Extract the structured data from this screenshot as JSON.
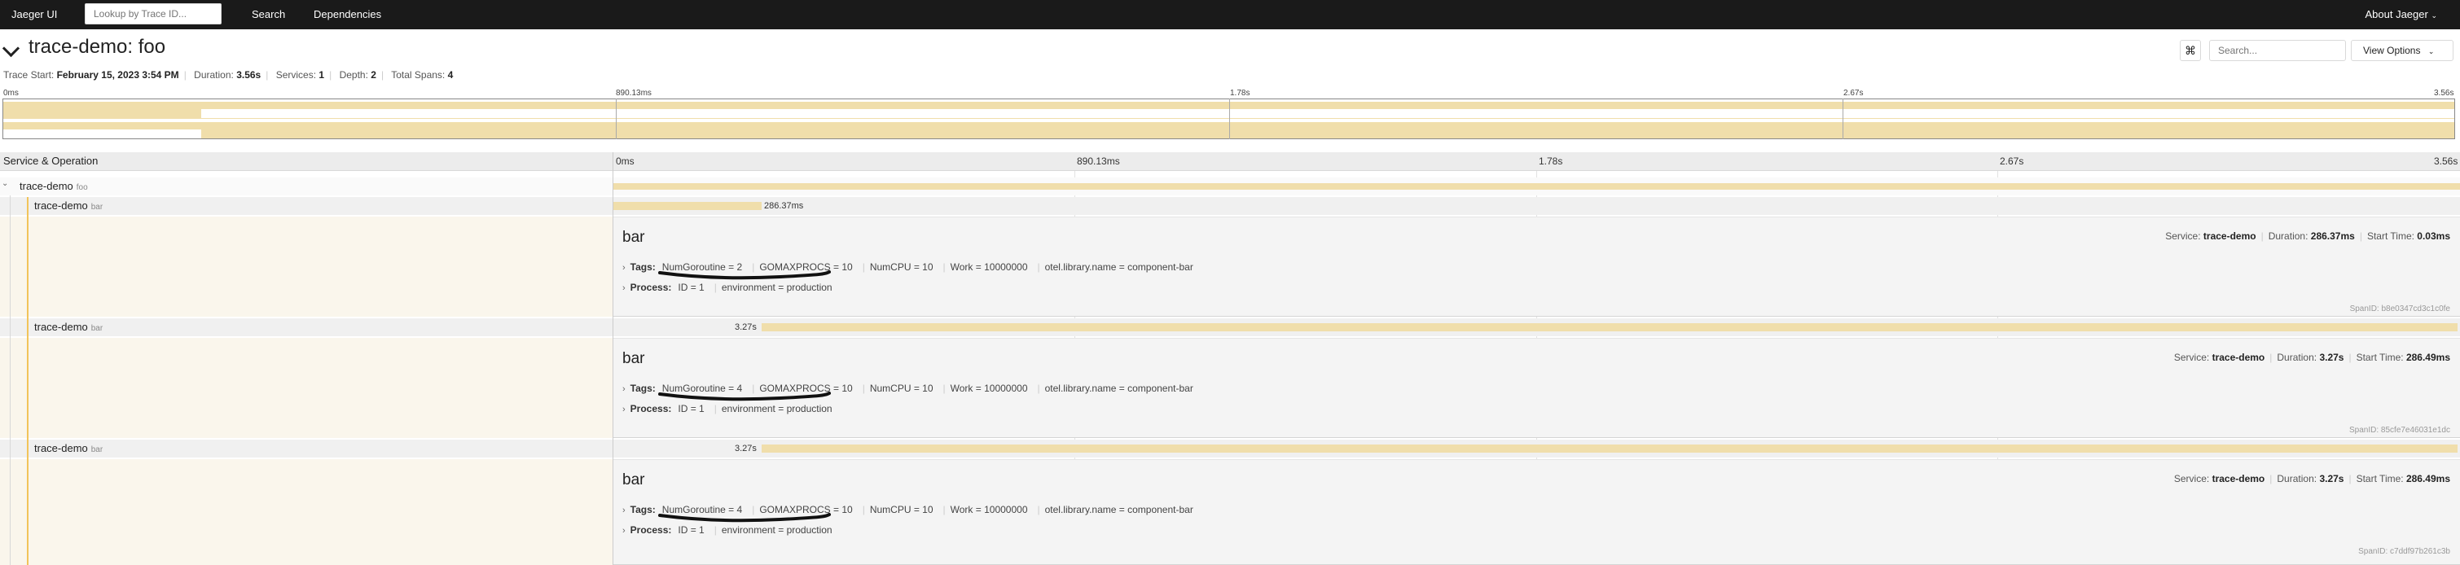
{
  "nav": {
    "brand": "Jaeger UI",
    "lookup_placeholder": "Lookup by Trace ID...",
    "search": "Search",
    "dependencies": "Dependencies",
    "about": "About Jaeger"
  },
  "trace": {
    "title": "trace-demo: foo",
    "start_label": "Trace Start:",
    "start": "February 15, 2023 3:54 PM",
    "duration_label": "Duration:",
    "duration": "3.56s",
    "services_label": "Services:",
    "services": "1",
    "depth_label": "Depth:",
    "depth": "2",
    "spans_label": "Total Spans:",
    "spans": "4",
    "search_placeholder": "Search...",
    "view_options": "View Options"
  },
  "timeline": {
    "ticks": [
      "0ms",
      "890.13ms",
      "1.78s",
      "2.67s",
      "3.56s"
    ],
    "header": "Service & Operation"
  },
  "spans": [
    {
      "service": "trace-demo",
      "op": "foo",
      "duration_label": ""
    },
    {
      "service": "trace-demo",
      "op": "bar",
      "duration_label": "286.37ms"
    },
    {
      "service": "trace-demo",
      "op": "bar",
      "duration_label": "3.27s"
    },
    {
      "service": "trace-demo",
      "op": "bar",
      "duration_label": "3.27s"
    }
  ],
  "details": [
    {
      "title": "bar",
      "service_label": "Service:",
      "service": "trace-demo",
      "duration_label": "Duration:",
      "duration": "286.37ms",
      "start_label": "Start Time:",
      "start": "0.03ms",
      "tags_label": "Tags:",
      "tags": [
        "NumGoroutine = 2",
        "GOMAXPROCS = 10",
        "NumCPU = 10",
        "Work = 10000000",
        "otel.library.name = component-bar"
      ],
      "process_label": "Process:",
      "process": [
        "ID = 1",
        "environment = production"
      ],
      "span_id": "SpanID: b8e0347cd3c1c0fe"
    },
    {
      "title": "bar",
      "service_label": "Service:",
      "service": "trace-demo",
      "duration_label": "Duration:",
      "duration": "3.27s",
      "start_label": "Start Time:",
      "start": "286.49ms",
      "tags_label": "Tags:",
      "tags": [
        "NumGoroutine = 4",
        "GOMAXPROCS = 10",
        "NumCPU = 10",
        "Work = 10000000",
        "otel.library.name = component-bar"
      ],
      "process_label": "Process:",
      "process": [
        "ID = 1",
        "environment = production"
      ],
      "span_id": "SpanID: 85cfe7e46031e1dc"
    },
    {
      "title": "bar",
      "service_label": "Service:",
      "service": "trace-demo",
      "duration_label": "Duration:",
      "duration": "3.27s",
      "start_label": "Start Time:",
      "start": "286.49ms",
      "tags_label": "Tags:",
      "tags": [
        "NumGoroutine = 4",
        "GOMAXPROCS = 10",
        "NumCPU = 10",
        "Work = 10000000",
        "otel.library.name = component-bar"
      ],
      "process_label": "Process:",
      "process": [
        "ID = 1",
        "environment = production"
      ],
      "span_id": "SpanID: c7ddf97b261c3b"
    }
  ],
  "colors": {
    "topbar": "#1a1a1a",
    "span_bar": "#f0deab",
    "guide": "#f2c45a",
    "detail_bg": "#f4f4f4"
  }
}
